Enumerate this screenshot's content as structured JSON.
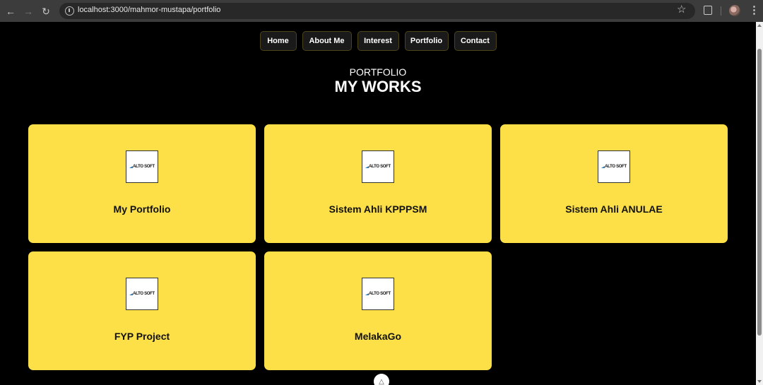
{
  "browser": {
    "url": "localhost:3000/mahmor-mustapa/portfolio"
  },
  "nav": {
    "items": [
      {
        "label": "Home"
      },
      {
        "label": "About Me"
      },
      {
        "label": "Interest"
      },
      {
        "label": "Portfolio"
      },
      {
        "label": "Contact"
      }
    ]
  },
  "section": {
    "label": "PORTFOLIO",
    "title": "MY WORKS"
  },
  "cards": [
    {
      "title": "My Portfolio",
      "logo_text": "ALTO SOFT"
    },
    {
      "title": "Sistem Ahli KPPPSM",
      "logo_text": "ALTO SOFT"
    },
    {
      "title": "Sistem Ahli ANULAE",
      "logo_text": "ALTO SOFT"
    },
    {
      "title": "FYP Project",
      "logo_text": "ALTO SOFT"
    },
    {
      "title": "MelakaGo",
      "logo_text": "ALTO SOFT"
    }
  ],
  "colors": {
    "card_background": "#fde047",
    "page_background": "#000000",
    "browser_chrome": "#3c3c3c"
  },
  "icons": {
    "back": "arrow-left-icon",
    "forward": "arrow-right-icon",
    "reload": "reload-icon",
    "site_info": "site-info-icon",
    "bookmark": "star-icon",
    "extensions": "puzzle-icon",
    "profile": "avatar",
    "menu": "kebab-menu-icon",
    "dev_badge": "nuxt-devtools-icon"
  }
}
